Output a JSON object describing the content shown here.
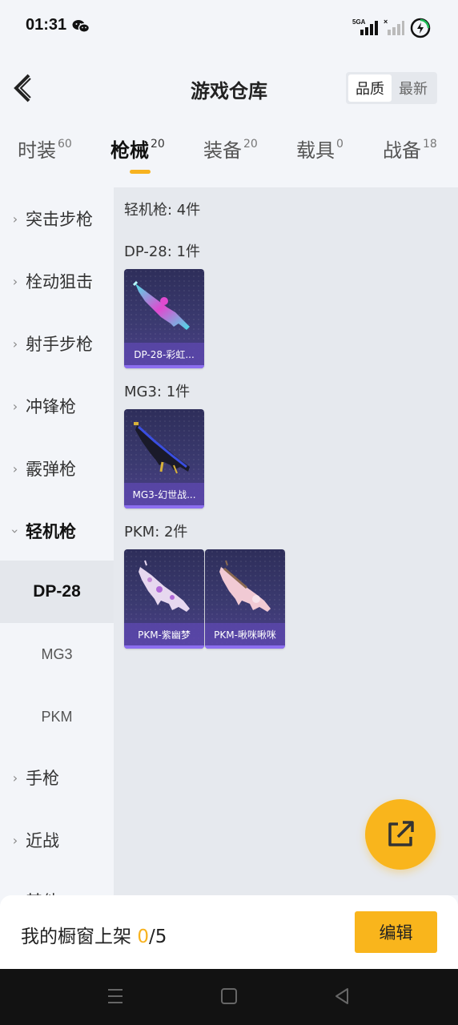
{
  "status_bar": {
    "time": "01:31",
    "network_label": "5GA",
    "icons": [
      "wechat-icon",
      "signal-5g-icon",
      "signal-icon",
      "battery-charging-icon"
    ]
  },
  "header": {
    "title": "游戏仓库",
    "back_icon": "back-arrow-icon",
    "sort_options": [
      "品质",
      "最新"
    ],
    "sort_active": "品质"
  },
  "tabs": [
    {
      "label": "时装",
      "count": "60"
    },
    {
      "label": "枪械",
      "count": "20",
      "active": true
    },
    {
      "label": "装备",
      "count": "20"
    },
    {
      "label": "载具",
      "count": "0"
    },
    {
      "label": "战备",
      "count": "18"
    }
  ],
  "sidebar": {
    "items": [
      {
        "label": "突击步枪"
      },
      {
        "label": "栓动狙击"
      },
      {
        "label": "射手步枪"
      },
      {
        "label": "冲锋枪"
      },
      {
        "label": "霰弹枪"
      },
      {
        "label": "轻机枪",
        "expanded": true
      },
      {
        "label": "手枪"
      },
      {
        "label": "近战"
      },
      {
        "label": "其他"
      }
    ],
    "sub_items": [
      {
        "label": "DP-28",
        "active": true
      },
      {
        "label": "MG3"
      },
      {
        "label": "PKM"
      }
    ]
  },
  "content": {
    "group_title": "轻机枪: 4件",
    "categories": [
      {
        "title": "DP-28: 1件",
        "items": [
          {
            "name": "DP-28-彩虹...",
            "icon": "lmg-rainbow-skin"
          }
        ]
      },
      {
        "title": "MG3: 1件",
        "items": [
          {
            "name": "MG3-幻世战...",
            "icon": "lmg-dark-skin"
          }
        ]
      },
      {
        "title": "PKM: 2件",
        "items": [
          {
            "name": "PKM-紫幽梦",
            "icon": "lmg-purple-skin"
          },
          {
            "name": "PKM-啾咪啾咪",
            "icon": "lmg-pink-skin"
          }
        ]
      }
    ]
  },
  "share_button": {
    "icon": "share-external-icon"
  },
  "bottom_bar": {
    "shelf_label": "我的橱窗上架",
    "shelf_current": "0",
    "shelf_total": "/5",
    "edit_label": "编辑"
  },
  "nav_bar": {
    "icons": [
      "menu-icon",
      "home-square-icon",
      "back-triangle-icon"
    ]
  },
  "colors": {
    "accent": "#f9b51c",
    "card_bg": "#3b3a70",
    "card_label": "#5a46aa"
  }
}
